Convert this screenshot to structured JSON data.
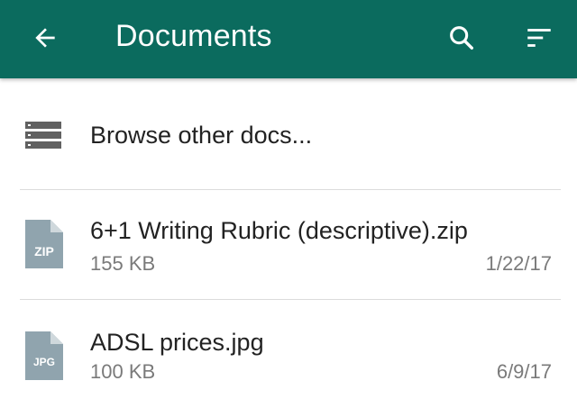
{
  "appbar": {
    "title": "Documents",
    "color": "#0b6b5e",
    "back_icon": "arrow-left-icon",
    "search_icon": "search-icon",
    "sort_icon": "sort-icon"
  },
  "browse": {
    "label": "Browse other docs...",
    "icon": "folder-list-icon"
  },
  "files": [
    {
      "name": "6+1 Writing Rubric (descriptive).zip",
      "type_badge": "ZIP",
      "size": "155 KB",
      "date": "1/22/17"
    },
    {
      "name": "ADSL prices.jpg",
      "type_badge": "JPG",
      "size": "100 KB",
      "date": "6/9/17"
    }
  ]
}
